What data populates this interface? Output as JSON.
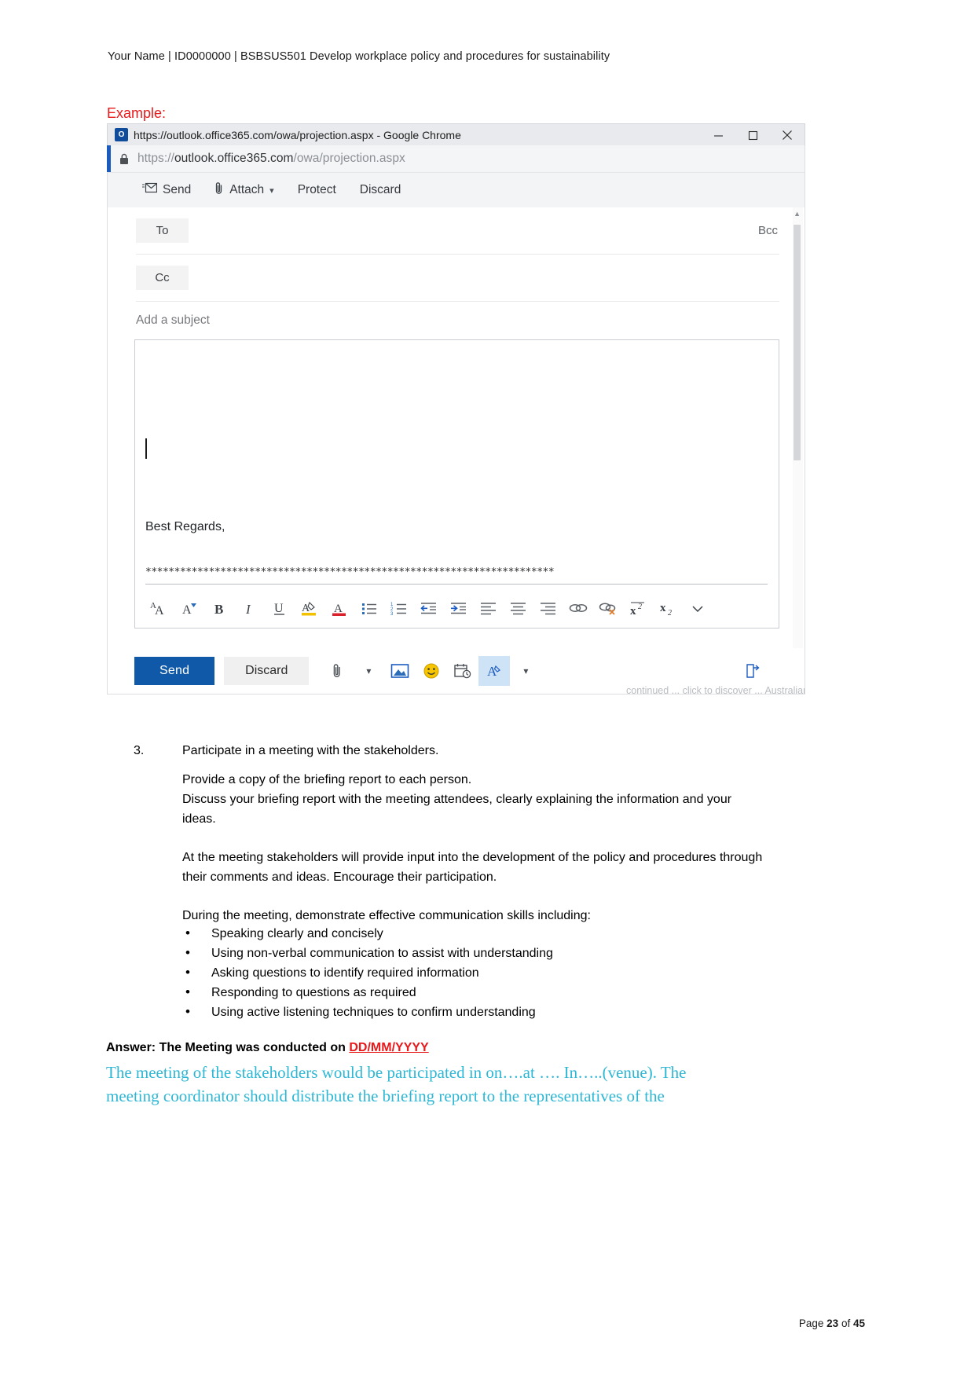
{
  "document": {
    "header": "Your Name | ID0000000 | BSBSUS501 Develop workplace policy and procedures for sustainability",
    "example_label": "Example:",
    "footer_prefix": "Page ",
    "footer_page": "23",
    "footer_mid": " of ",
    "footer_total": "45"
  },
  "browser": {
    "title": "https://outlook.office365.com/owa/projection.aspx - Google Chrome",
    "app_icon": "outlook-icon",
    "url_prefix": "https://",
    "url_domain": "outlook.office365.com",
    "url_path": "/owa/projection.aspx",
    "lock_icon": "lock-icon",
    "minimize_label": "minimize-icon",
    "maximize_label": "maximize-icon",
    "close_label": "close-icon"
  },
  "compose": {
    "commands": [
      {
        "label": "Send",
        "icon": "send-mail-icon",
        "chevron": false
      },
      {
        "label": "Attach",
        "icon": "paperclip-icon",
        "chevron": true
      },
      {
        "label": "Protect",
        "icon": "",
        "chevron": false
      },
      {
        "label": "Discard",
        "icon": "",
        "chevron": false
      }
    ],
    "to_label": "To",
    "cc_label": "Cc",
    "bcc_label": "Bcc",
    "to_value": "",
    "cc_value": "",
    "subject_placeholder": "Add a subject",
    "body_signature": "Best Regards,",
    "body_separator": "***********************************************************************",
    "format_tools": [
      "font-size-icon",
      "font-grow-icon",
      "bold-icon",
      "italic-icon",
      "underline-icon",
      "highlight-color-icon",
      "font-color-icon",
      "bulleted-list-icon",
      "numbered-list-icon",
      "decrease-indent-icon",
      "increase-indent-icon",
      "align-left-icon",
      "align-center-icon",
      "align-right-icon",
      "insert-link-icon",
      "remove-link-icon",
      "superscript-icon",
      "subscript-icon",
      "more-formatting-icon"
    ],
    "send_button": "Send",
    "discard_button": "Discard",
    "action_tools": [
      "attach-icon",
      "attach-chevron-icon",
      "insert-picture-icon",
      "emoji-icon",
      "schedule-icon",
      "formatting-options-icon",
      "more-options-icon"
    ],
    "popout_icon": "pop-out-icon",
    "ghost_text": "continued ... click to discover ... Australian training courses"
  },
  "task": {
    "number": "3.",
    "title": "Participate in a meeting with the stakeholders.",
    "paragraphs": [
      "Provide a copy of the briefing report to each person.\nDiscuss your briefing report with the meeting attendees, clearly explaining the information and your ideas.",
      "At the meeting stakeholders will provide input into the development of the policy and procedures through their comments and ideas. Encourage their participation.",
      "During the meeting, demonstrate effective communication skills including:"
    ],
    "bullets": [
      "Speaking clearly and concisely",
      "Using non-verbal communication to assist with understanding",
      "Asking questions to identify required information",
      "Responding to questions as required",
      "Using active listening techniques to confirm understanding"
    ]
  },
  "answer": {
    "prefix": "Answer: The Meeting was conducted on ",
    "date_placeholder": "DD/MM/YYYY",
    "response": "The meeting of the stakeholders would be participated in on….at …. In…..(venue). The meeting coordinator should distribute the briefing report to the representatives of the"
  }
}
